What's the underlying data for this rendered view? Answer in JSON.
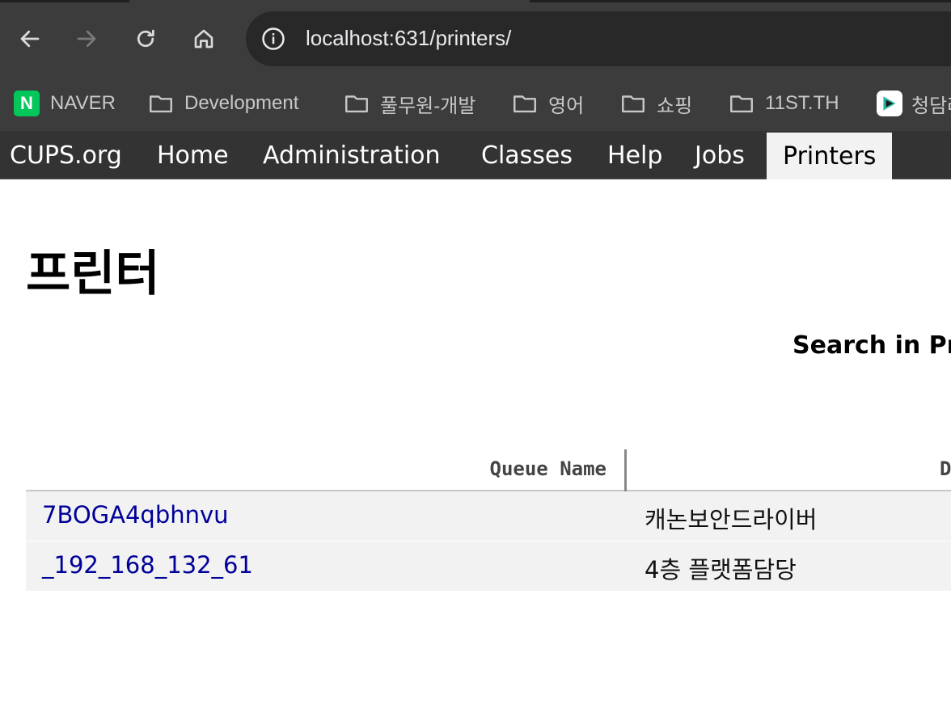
{
  "browser": {
    "url": "localhost:631/printers/",
    "icons": {
      "back": "back-arrow-icon",
      "forward": "forward-arrow-icon",
      "reload": "reload-icon",
      "home": "home-icon",
      "site_info": "info-icon"
    }
  },
  "bookmarks": {
    "items": [
      {
        "label": "NAVER",
        "icon": "naver-logo"
      },
      {
        "label": "Development",
        "icon": "folder-icon"
      },
      {
        "label": "풀무원-개발",
        "icon": "folder-icon"
      },
      {
        "label": "영어",
        "icon": "folder-icon"
      },
      {
        "label": "쇼핑",
        "icon": "folder-icon"
      },
      {
        "label": "11ST.TH",
        "icon": "folder-icon"
      },
      {
        "label": "청담러",
        "icon": "app-logo"
      }
    ],
    "naver_letter": "N"
  },
  "cups_nav": {
    "items": [
      "CUPS.org",
      "Home",
      "Administration",
      "Classes",
      "Help",
      "Jobs",
      "Printers"
    ],
    "active": "Printers"
  },
  "page": {
    "title": "프린터",
    "search_label": "Search in Pr"
  },
  "table": {
    "headers": [
      "Queue Name",
      "D"
    ],
    "rows": [
      {
        "queue_name": "7BOGA4qbhnvu",
        "description": "캐논보안드라이버"
      },
      {
        "queue_name": "_192_168_132_61",
        "description": "4층 플랫폼담당"
      }
    ]
  },
  "colors": {
    "chrome_bg": "#3c3c3c",
    "omnibox_bg": "#282828",
    "cups_nav_bg": "#333333",
    "link": "#000099",
    "row_bg": "#f2f2f2",
    "naver_green": "#03c75a"
  }
}
